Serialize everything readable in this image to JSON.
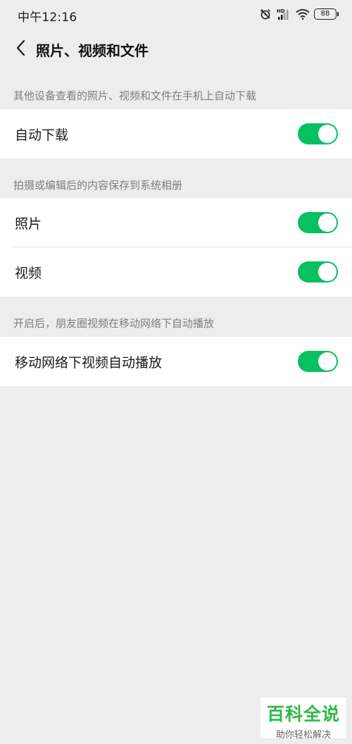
{
  "status_bar": {
    "time": "中午12:16",
    "battery": "88",
    "network": "HD"
  },
  "header": {
    "title": "照片、视频和文件"
  },
  "sections": [
    {
      "caption": "其他设备查看的照片、视频和文件在手机上自动下载",
      "items": [
        {
          "label": "自动下载",
          "enabled": true
        }
      ]
    },
    {
      "caption": "拍摄或编辑后的内容保存到系统相册",
      "items": [
        {
          "label": "照片",
          "enabled": true
        },
        {
          "label": "视频",
          "enabled": true
        }
      ]
    },
    {
      "caption": "开启后，朋友圈视频在移动网络下自动播放",
      "items": [
        {
          "label": "移动网络下视频自动播放",
          "enabled": true
        }
      ]
    }
  ],
  "colors": {
    "toggle_on": "#07c160",
    "background": "#ededed"
  },
  "watermark": {
    "title": "百科全说",
    "subtitle": "助你轻松解决"
  }
}
